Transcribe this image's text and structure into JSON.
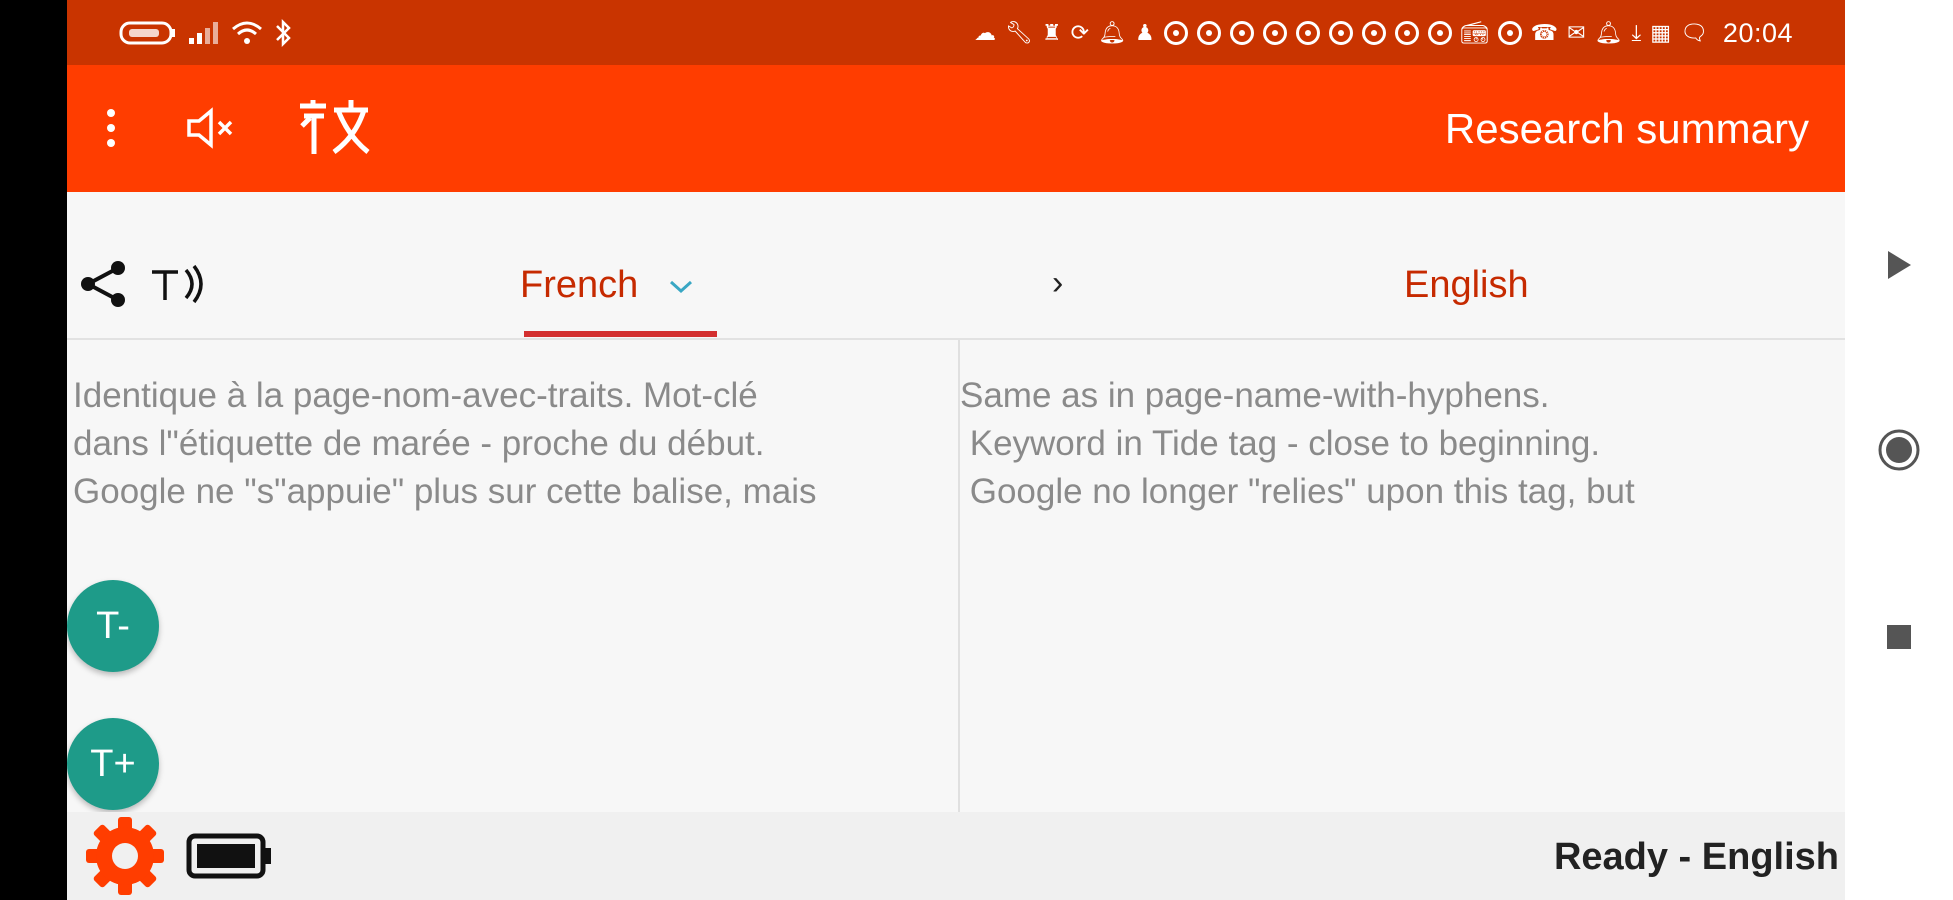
{
  "status_bar": {
    "time": "20:04",
    "left_icons": [
      "battery-saver-icon",
      "signal-icon",
      "wifi-icon",
      "bluetooth-icon"
    ],
    "right_icons": [
      "cloud-icon",
      "wrench-icon",
      "chess-icon",
      "sync-icon",
      "bell-icon",
      "chess-icon",
      "app-circle-icon",
      "app-circle-icon",
      "app-circle-icon",
      "app-circle-icon",
      "app-circle-icon",
      "app-circle-icon",
      "app-circle-icon",
      "app-circle-icon",
      "app-circle-icon",
      "radio-icon",
      "app-circle-icon",
      "call-icon",
      "mail-icon",
      "bell-icon",
      "download-icon",
      "grid-icon",
      "message-icon"
    ]
  },
  "toolbar": {
    "title": "Research summary",
    "icons": [
      "more-vert-icon",
      "volume-mute-icon",
      "translate-icon"
    ]
  },
  "language_bar": {
    "source_lang": "French",
    "target_lang": "English",
    "arrow": "›",
    "left_icons": [
      "share-icon",
      "text-to-speech-icon"
    ]
  },
  "source_text": "Identique à la page-nom-avec-traits. Mot-clé\ndans l\"étiquette de marée - proche du début.\nGoogle ne \"s\"appuie\" plus sur cette balise, mais",
  "target_text": "Same as in page-name-with-hyphens.\n Keyword in Tide tag - close to beginning.\n Google no longer \"relies\" upon this tag, but",
  "fabs": {
    "decrease_label": "T-",
    "increase_label": "T+"
  },
  "bottom_bar": {
    "status": "Ready - English"
  },
  "colors": {
    "status_bar": "#c93400",
    "toolbar": "#ff3d00",
    "accent_text": "#c62a00",
    "fab": "#1e9b89"
  }
}
